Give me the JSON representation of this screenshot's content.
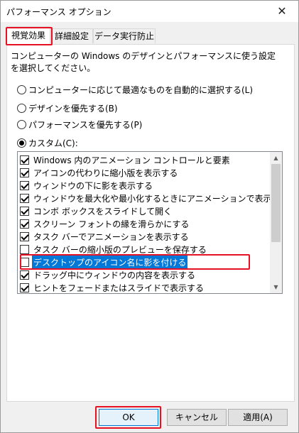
{
  "window": {
    "title": "パフォーマンス オプション",
    "close_glyph": "✕"
  },
  "tabs": [
    {
      "label": "視覚効果",
      "active": true
    },
    {
      "label": "詳細設定",
      "active": false
    },
    {
      "label": "データ実行防止",
      "active": false
    }
  ],
  "description": "コンピューターの Windows のデザインとパフォーマンスに使う設定を選択してください。",
  "radios": [
    {
      "label": "コンピューターに応じて最適なものを自動的に選択する(L)",
      "checked": false
    },
    {
      "label": "デザインを優先する(B)",
      "checked": false
    },
    {
      "label": "パフォーマンスを優先する(P)",
      "checked": false
    },
    {
      "label": "カスタム(C):",
      "checked": true
    }
  ],
  "effects": [
    {
      "label": "Windows 内のアニメーション コントロールと要素",
      "checked": true
    },
    {
      "label": "アイコンの代わりに縮小版を表示する",
      "checked": true
    },
    {
      "label": "ウィンドウの下に影を表示する",
      "checked": true
    },
    {
      "label": "ウィンドウを最大化や最小化するときにアニメーションで表示する",
      "checked": true
    },
    {
      "label": "コンボ ボックスをスライドして開く",
      "checked": true
    },
    {
      "label": "スクリーン フォントの縁を滑らかにする",
      "checked": true
    },
    {
      "label": "タスク バーでアニメーションを表示する",
      "checked": true
    },
    {
      "label": "タスク バーの縮小版のプレビューを保存する",
      "checked": false
    },
    {
      "label": "デスクトップのアイコン名に影を付ける",
      "checked": false,
      "selected": true
    },
    {
      "label": "ドラッグ中にウィンドウの内容を表示する",
      "checked": true
    },
    {
      "label": "ヒントをフェードまたはスライドで表示する",
      "checked": true
    }
  ],
  "buttons": {
    "ok": "OK",
    "cancel": "キャンセル",
    "apply": "適用(A)"
  },
  "colors": {
    "highlight_red": "#e81123",
    "selection_blue": "#0078d7"
  }
}
